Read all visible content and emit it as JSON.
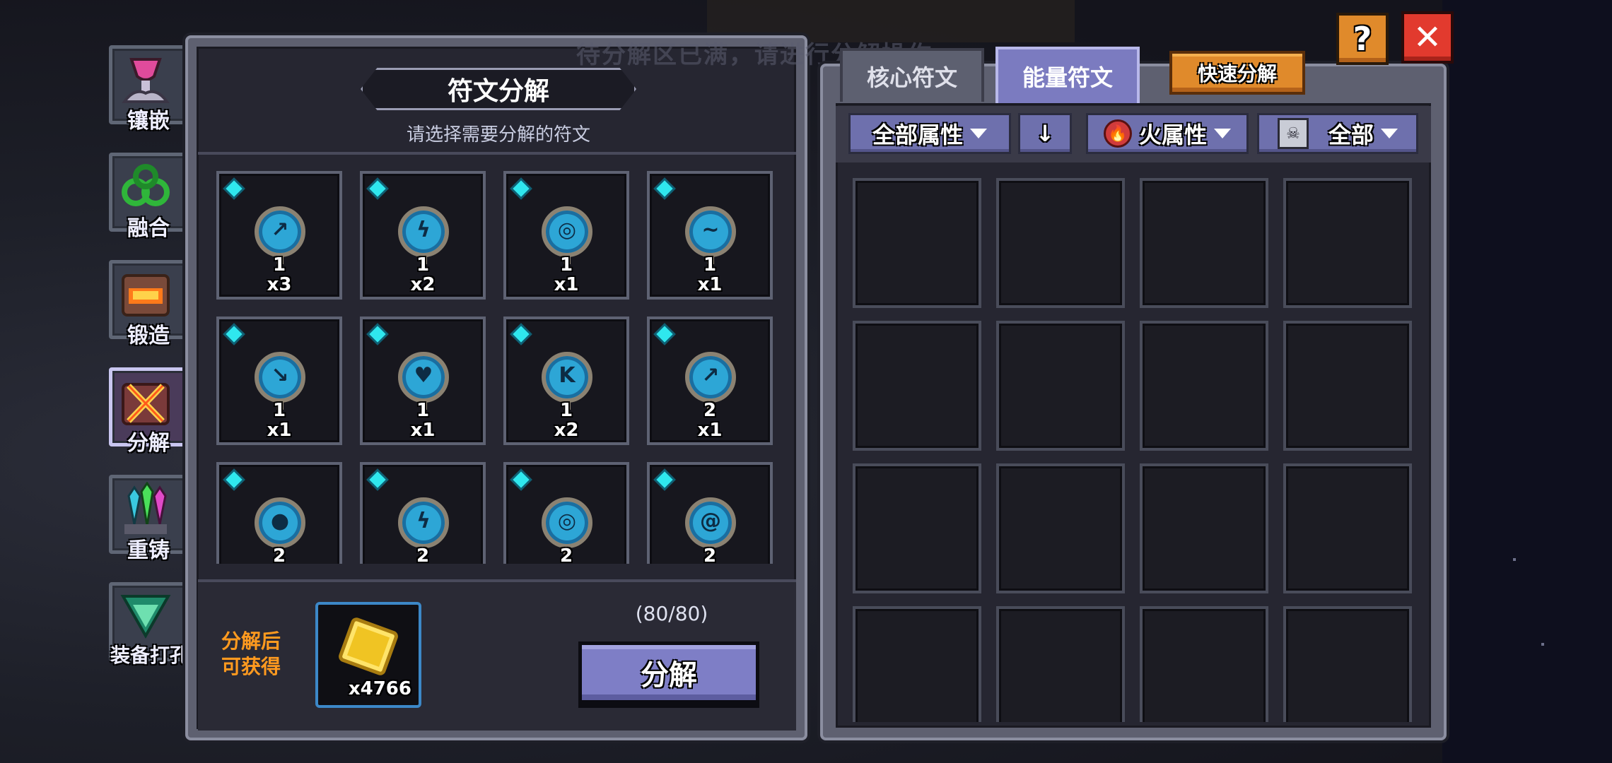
{
  "header": {
    "ghost_notice": "待分解区已满，请进行分解操作",
    "help_label": "?",
    "close_label": "✕"
  },
  "nav": {
    "items": [
      {
        "label": "镶嵌",
        "icon": "inlay-icon"
      },
      {
        "label": "融合",
        "icon": "fusion-icon"
      },
      {
        "label": "锻造",
        "icon": "forge-icon"
      },
      {
        "label": "分解",
        "icon": "decompose-icon",
        "active": true
      },
      {
        "label": "重铸",
        "icon": "recast-icon"
      },
      {
        "label": "装备打孔",
        "icon": "socket-drill-icon"
      }
    ]
  },
  "decompose_panel": {
    "title": "符文分解",
    "subtitle": "请选择需要分解的符文",
    "runes": [
      {
        "level": "1",
        "qty": "x3",
        "glyph": "↗"
      },
      {
        "level": "1",
        "qty": "x2",
        "glyph": "ϟ"
      },
      {
        "level": "1",
        "qty": "x1",
        "glyph": "◎"
      },
      {
        "level": "1",
        "qty": "x1",
        "glyph": "~"
      },
      {
        "level": "1",
        "qty": "x1",
        "glyph": "↘"
      },
      {
        "level": "1",
        "qty": "x1",
        "glyph": "♥"
      },
      {
        "level": "1",
        "qty": "x2",
        "glyph": "K"
      },
      {
        "level": "2",
        "qty": "x1",
        "glyph": "↗"
      },
      {
        "level": "2",
        "qty": "",
        "glyph": "●"
      },
      {
        "level": "2",
        "qty": "",
        "glyph": "ϟ"
      },
      {
        "level": "2",
        "qty": "",
        "glyph": "◎"
      },
      {
        "level": "2",
        "qty": "",
        "glyph": "@"
      }
    ],
    "gain_label": "分解后可获得",
    "reward_qty": "x4766",
    "reward_icon": "gold-coin-icon",
    "capacity": "(80/80)",
    "decompose_button": "分解"
  },
  "rune_inventory": {
    "tabs": [
      {
        "label": "核心符文",
        "active": false
      },
      {
        "label": "能量符文",
        "active": true
      }
    ],
    "quick_decompose_button": "快速分解",
    "filters": {
      "attribute": "全部属性",
      "sort_icon": "↓",
      "element": "火属性",
      "element_icon": "fire-icon",
      "category": "全部",
      "category_icon": "monster-icon"
    },
    "empty_slots": 16
  },
  "colors": {
    "accent_purple": "#7e7ec6",
    "accent_orange": "#e08a2b",
    "close_red": "#e23a2e",
    "gain_orange": "#ff9a1f",
    "gem_cyan": "#2fe7ee"
  }
}
